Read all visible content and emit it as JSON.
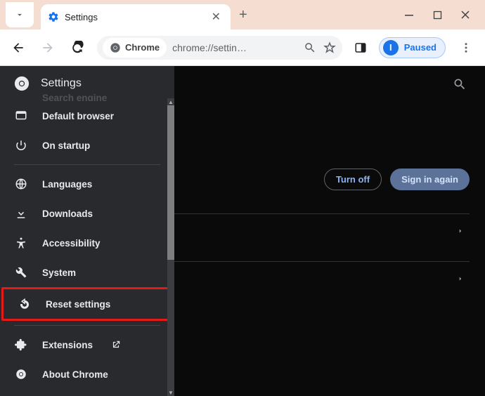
{
  "window": {
    "tab_title": "Settings",
    "new_tab_tooltip": "New tab"
  },
  "toolbar": {
    "chip_label": "Chrome",
    "url": "chrome://settin…",
    "paused_label": "Paused",
    "avatar_initial": "I"
  },
  "sidebar": {
    "title": "Settings",
    "items": [
      {
        "icon": "search",
        "label": "Search engine",
        "cut": true
      },
      {
        "icon": "default-browser",
        "label": "Default browser"
      },
      {
        "icon": "power",
        "label": "On startup"
      },
      {
        "divider": true
      },
      {
        "icon": "globe",
        "label": "Languages"
      },
      {
        "icon": "download",
        "label": "Downloads"
      },
      {
        "icon": "accessibility",
        "label": "Accessibility"
      },
      {
        "icon": "wrench",
        "label": "System"
      },
      {
        "icon": "reset",
        "label": "Reset settings",
        "highlight": true
      },
      {
        "divider": true
      },
      {
        "icon": "extension",
        "label": "Extensions",
        "external": true
      },
      {
        "icon": "chrome",
        "label": "About Chrome"
      }
    ]
  },
  "main": {
    "turn_off_label": "Turn off",
    "sign_in_label": "Sign in again"
  }
}
